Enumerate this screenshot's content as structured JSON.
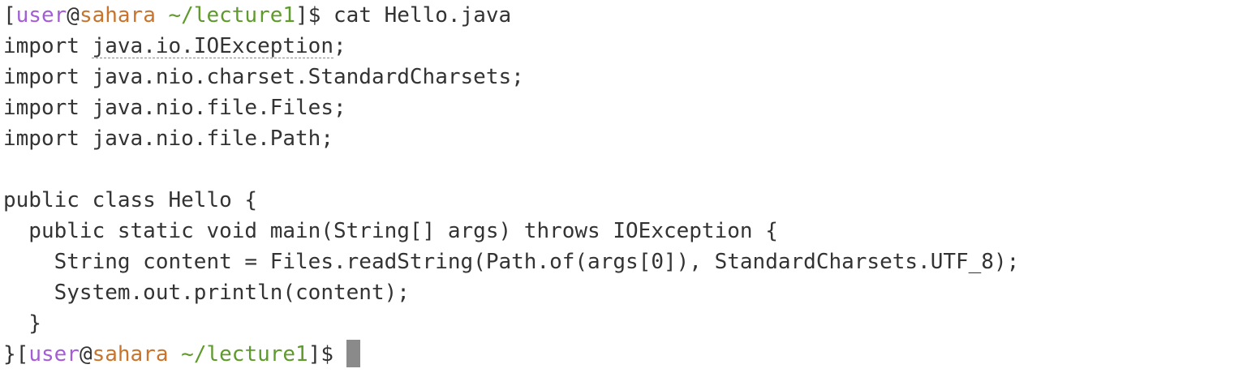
{
  "prompt": {
    "open_bracket": "[",
    "user": "user",
    "at": "@",
    "host": "sahara",
    "space": " ",
    "path": "~/lecture1",
    "close_bracket": "]",
    "dollar": "$ "
  },
  "command": "cat Hello.java",
  "file_lines": {
    "l1_prefix": "import ",
    "l1_squiggle": "java.io.IOException",
    "l1_suffix": ";",
    "l2": "import java.nio.charset.StandardCharsets;",
    "l3": "import java.nio.file.Files;",
    "l4": "import java.nio.file.Path;",
    "l5": "",
    "l6": "public class Hello {",
    "l7": "  public static void main(String[] args) throws IOException {",
    "l8": "    String content = Files.readString(Path.of(args[0]), StandardCharsets.UTF_8);",
    "l9": "    System.out.println(content);",
    "l10": "  }",
    "l11_prefix": "}"
  },
  "colors": {
    "user": "#a45dd6",
    "host": "#c8742c",
    "path": "#5f9a2c",
    "text": "#333333",
    "cursor": "#8a8a8a"
  }
}
